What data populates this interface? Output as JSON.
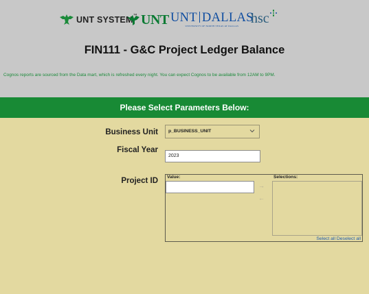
{
  "header": {
    "logos": {
      "unt_system": "UNT SYSTEM",
      "unt": "UNT",
      "unt_dallas": [
        "UNT",
        "DALLAS"
      ],
      "unt_dallas_sub": "UNIVERSITY OF NORTH TEXAS AT DALLAS",
      "hsc": "hsc"
    },
    "title": "FIN111 - G&C Project Ledger Balance",
    "notice": "Cognos reports are sourced from the Data mart, which is refreshed every night. You can expect Cognos to be available from 12AM to 9PM."
  },
  "params_bar": {
    "label": "Please Select Parameters Below:"
  },
  "form": {
    "business_unit": {
      "label": "Business Unit",
      "selected": "p_BUSINESS_UNIT"
    },
    "fiscal_year": {
      "label": "Fiscal Year",
      "value": "2023"
    },
    "project_id": {
      "label": "Project ID",
      "value_label": "Value:",
      "selections_label": "Selections:",
      "value": "",
      "select_all": "Select all",
      "deselect_all": "Deselect all"
    }
  },
  "colors": {
    "header_bg": "#c8c8c8",
    "page_bg": "#e3d9a0",
    "green_bar": "#188a35",
    "notice_text": "#1b8a3a",
    "link": "#1d5cb0"
  },
  "icons": [
    "eagle-icon",
    "chevron-down-icon",
    "arrow-right-icon",
    "arrow-left-icon",
    "hsc-dots-icon"
  ]
}
